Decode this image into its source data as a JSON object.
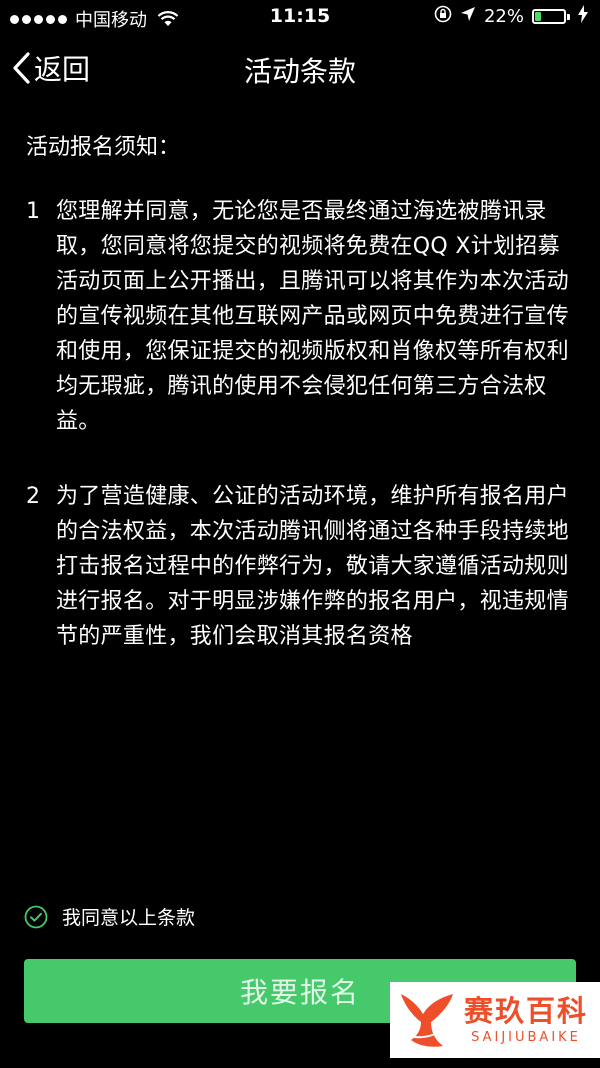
{
  "status_bar": {
    "carrier": "中国移动",
    "time": "11:15",
    "battery": "22%",
    "battery_level": 0.22
  },
  "nav": {
    "back_label": "返回",
    "title": "活动条款"
  },
  "content": {
    "heading": "活动报名须知：",
    "terms": [
      {
        "number": "1",
        "text": "您理解并同意，无论您是否最终通过海选被腾讯录取，您同意将您提交的视频将免费在QQ X计划招募活动页面上公开播出，且腾讯可以将其作为本次活动的宣传视频在其他互联网产品或网页中免费进行宣传和使用，您保证提交的视频版权和肖像权等所有权利均无瑕疵，腾讯的使用不会侵犯任何第三方合法权益。"
      },
      {
        "number": "2",
        "text": "为了营造健康、公证的活动环境，维护所有报名用户的合法权益，本次活动腾讯侧将通过各种手段持续地打击报名过程中的作弊行为，敬请大家遵循活动规则进行报名。对于明显涉嫌作弊的报名用户，视违规情节的严重性，我们会取消其报名资格"
      }
    ]
  },
  "agree": {
    "label": "我同意以上条款",
    "checked": true
  },
  "signup_button": {
    "label": "我要报名",
    "color": "#45c96a"
  },
  "watermark": {
    "cn": "赛玖百科",
    "en": "SAIJIUBAIKE",
    "color": "#ee4f2a"
  }
}
